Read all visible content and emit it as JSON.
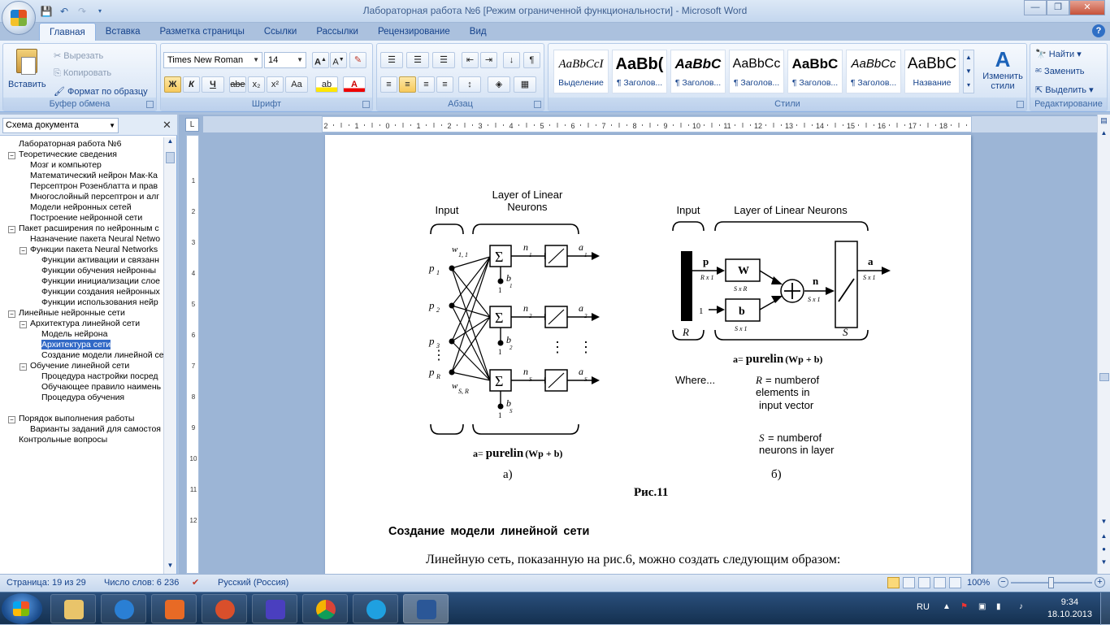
{
  "window": {
    "title": "Лабораторная работа №6 [Режим ограниченной функциональности] - Microsoft Word"
  },
  "tabs": [
    "Главная",
    "Вставка",
    "Разметка страницы",
    "Ссылки",
    "Рассылки",
    "Рецензирование",
    "Вид"
  ],
  "clipboard": {
    "paste": "Вставить",
    "cut": "Вырезать",
    "copy": "Копировать",
    "format_painter": "Формат по образцу",
    "label": "Буфер обмена"
  },
  "font": {
    "name": "Times New Roman",
    "size": "14",
    "label": "Шрифт",
    "bold": "Ж",
    "italic": "К",
    "underline": "Ч",
    "strike": "abe",
    "sub": "x₂",
    "sup": "x²",
    "case": "Aa"
  },
  "paragraph": {
    "label": "Абзац"
  },
  "styles": {
    "label": "Стили",
    "items": [
      {
        "sample": "AaBbCcI",
        "name": "Выделение"
      },
      {
        "sample": "AaBb(",
        "name": "¶ Заголов..."
      },
      {
        "sample": "AaBbC",
        "name": "¶ Заголов..."
      },
      {
        "sample": "AaBbCc",
        "name": "¶ Заголов..."
      },
      {
        "sample": "AaBbC",
        "name": "¶ Заголов..."
      },
      {
        "sample": "AaBbCc",
        "name": "¶ Заголов..."
      },
      {
        "sample": "AaBbC",
        "name": "Название"
      }
    ],
    "change": "Изменить стили"
  },
  "editing": {
    "label": "Редактирование",
    "find": "Найти",
    "replace": "Заменить",
    "select": "Выделить"
  },
  "nav": {
    "selector": "Схема документа",
    "items": [
      {
        "text": "Лабораторная работа №6",
        "level": 0,
        "exp": ""
      },
      {
        "text": "Теоретические сведения",
        "level": 0,
        "exp": "−"
      },
      {
        "text": "Мозг и компьютер",
        "level": 1,
        "exp": ""
      },
      {
        "text": "Математический нейрон Мак-Ка",
        "level": 1,
        "exp": ""
      },
      {
        "text": "Персептрон Розенблатта и прав",
        "level": 1,
        "exp": ""
      },
      {
        "text": "Многослойный персептрон и алг",
        "level": 1,
        "exp": ""
      },
      {
        "text": "Модели нейронных сетей",
        "level": 1,
        "exp": ""
      },
      {
        "text": "Построение нейронной сети",
        "level": 1,
        "exp": ""
      },
      {
        "text": "Пакет расширения по нейронным с",
        "level": 0,
        "exp": "−"
      },
      {
        "text": "Назначение пакета Neural Netwo",
        "level": 1,
        "exp": ""
      },
      {
        "text": "Функции пакета Neural Networks",
        "level": 1,
        "exp": "−"
      },
      {
        "text": "Функции активации и связанн",
        "level": 2,
        "exp": ""
      },
      {
        "text": "Функции обучения нейронны",
        "level": 2,
        "exp": ""
      },
      {
        "text": "Функции инициализации слое",
        "level": 2,
        "exp": ""
      },
      {
        "text": "Функции создания нейронных",
        "level": 2,
        "exp": ""
      },
      {
        "text": "Функции использования нейр",
        "level": 2,
        "exp": ""
      },
      {
        "text": "Линейные нейронные сети",
        "level": 0,
        "exp": "−"
      },
      {
        "text": "Архитектура линейной сети",
        "level": 1,
        "exp": "−"
      },
      {
        "text": "Модель нейрона",
        "level": 2,
        "exp": ""
      },
      {
        "text": "Архитектура сети",
        "level": 2,
        "exp": "",
        "selected": true
      },
      {
        "text": "Создание модели линейной се",
        "level": 2,
        "exp": ""
      },
      {
        "text": "Обучение линейной сети",
        "level": 1,
        "exp": "−"
      },
      {
        "text": "Процедура настройки посред",
        "level": 2,
        "exp": ""
      },
      {
        "text": "Обучающее правило наимень",
        "level": 2,
        "exp": ""
      },
      {
        "text": "Процедура обучения",
        "level": 2,
        "exp": ""
      },
      {
        "text": "",
        "level": 0,
        "exp": ""
      },
      {
        "text": "Порядок выполнения работы",
        "level": 0,
        "exp": "−"
      },
      {
        "text": "Варианты заданий для самостоя",
        "level": 1,
        "exp": ""
      },
      {
        "text": "Контрольные вопросы",
        "level": 0,
        "exp": ""
      }
    ]
  },
  "figure": {
    "a": {
      "input": "Input",
      "layer": "Layer of Linear",
      "layer2": "Neurons",
      "formula_a": "a",
      "formula_eq": "= ",
      "formula_fn": "purelin",
      "formula_arg": "(Wp + b)",
      "cap": "а)"
    },
    "b": {
      "input": "Input",
      "layer": "Layer of Linear Neurons",
      "where": "Where...",
      "r_def1": "= numberof",
      "r_def2": "elements in",
      "r_def3": "input vector",
      "s_def1": "= numberof",
      "s_def2": "neurons in layer",
      "cap": "б)"
    },
    "caption": "Рис.11"
  },
  "doc": {
    "heading": "Создание модели линейной сети",
    "para": "Линейную сеть, показанную на рис.6, можно создать следующим образом:"
  },
  "status": {
    "page": "Страница: 19 из 29",
    "words": "Число слов: 6 236",
    "lang": "Русский (Россия)",
    "zoom": "100%"
  },
  "taskbar": {
    "lang": "RU",
    "time": "9:34",
    "date": "18.10.2013"
  }
}
